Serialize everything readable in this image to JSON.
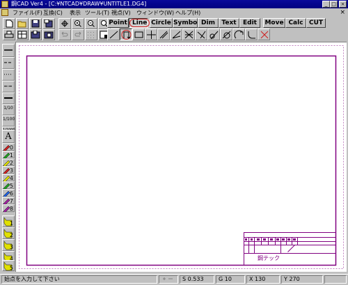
{
  "window": {
    "title": "鋼CAD Ver4 - [C:¥NTCAD¥DRAW¥UNTITLE1.DG4]",
    "minimize": "_",
    "maximize": "□",
    "close": "×"
  },
  "menu": {
    "items": [
      "ファイル(F)",
      "互換(C)",
      "表示",
      "ツール(T)",
      "視点(V)",
      "ウィンドウ(W)",
      "ヘルプ(H)"
    ],
    "close": "×"
  },
  "tabs": [
    {
      "label": "Point"
    },
    {
      "label": "Line",
      "active": true
    },
    {
      "label": "Circle"
    },
    {
      "label": "Symbol"
    },
    {
      "label": "Dim"
    },
    {
      "label": "Text"
    },
    {
      "label": "Edit"
    },
    {
      "label": "Move"
    },
    {
      "label": "Calc"
    },
    {
      "label": "CUT"
    }
  ],
  "palette": {
    "text_tool": "A",
    "scales": [
      "1/10",
      "1/100",
      "1/1000"
    ],
    "pens": [
      "0",
      "1",
      "2",
      "3",
      "4",
      "5",
      "6",
      "7",
      "8"
    ],
    "layers": [
      "1",
      "2",
      "3",
      "4",
      "5"
    ]
  },
  "title_block": {
    "company": "鋼テック"
  },
  "status": {
    "prompt": "始点を入力して下さい",
    "s_label": "S",
    "s_value": "0.533",
    "g_label": "G",
    "g_value": "10",
    "x_label": "X",
    "x_value": "130",
    "y_label": "Y",
    "y_value": "270"
  },
  "colors": {
    "title_bar": "#000080",
    "drawing_border": "#800080",
    "dashed_frame": "#c080c0",
    "highlight": "#cc2020"
  }
}
